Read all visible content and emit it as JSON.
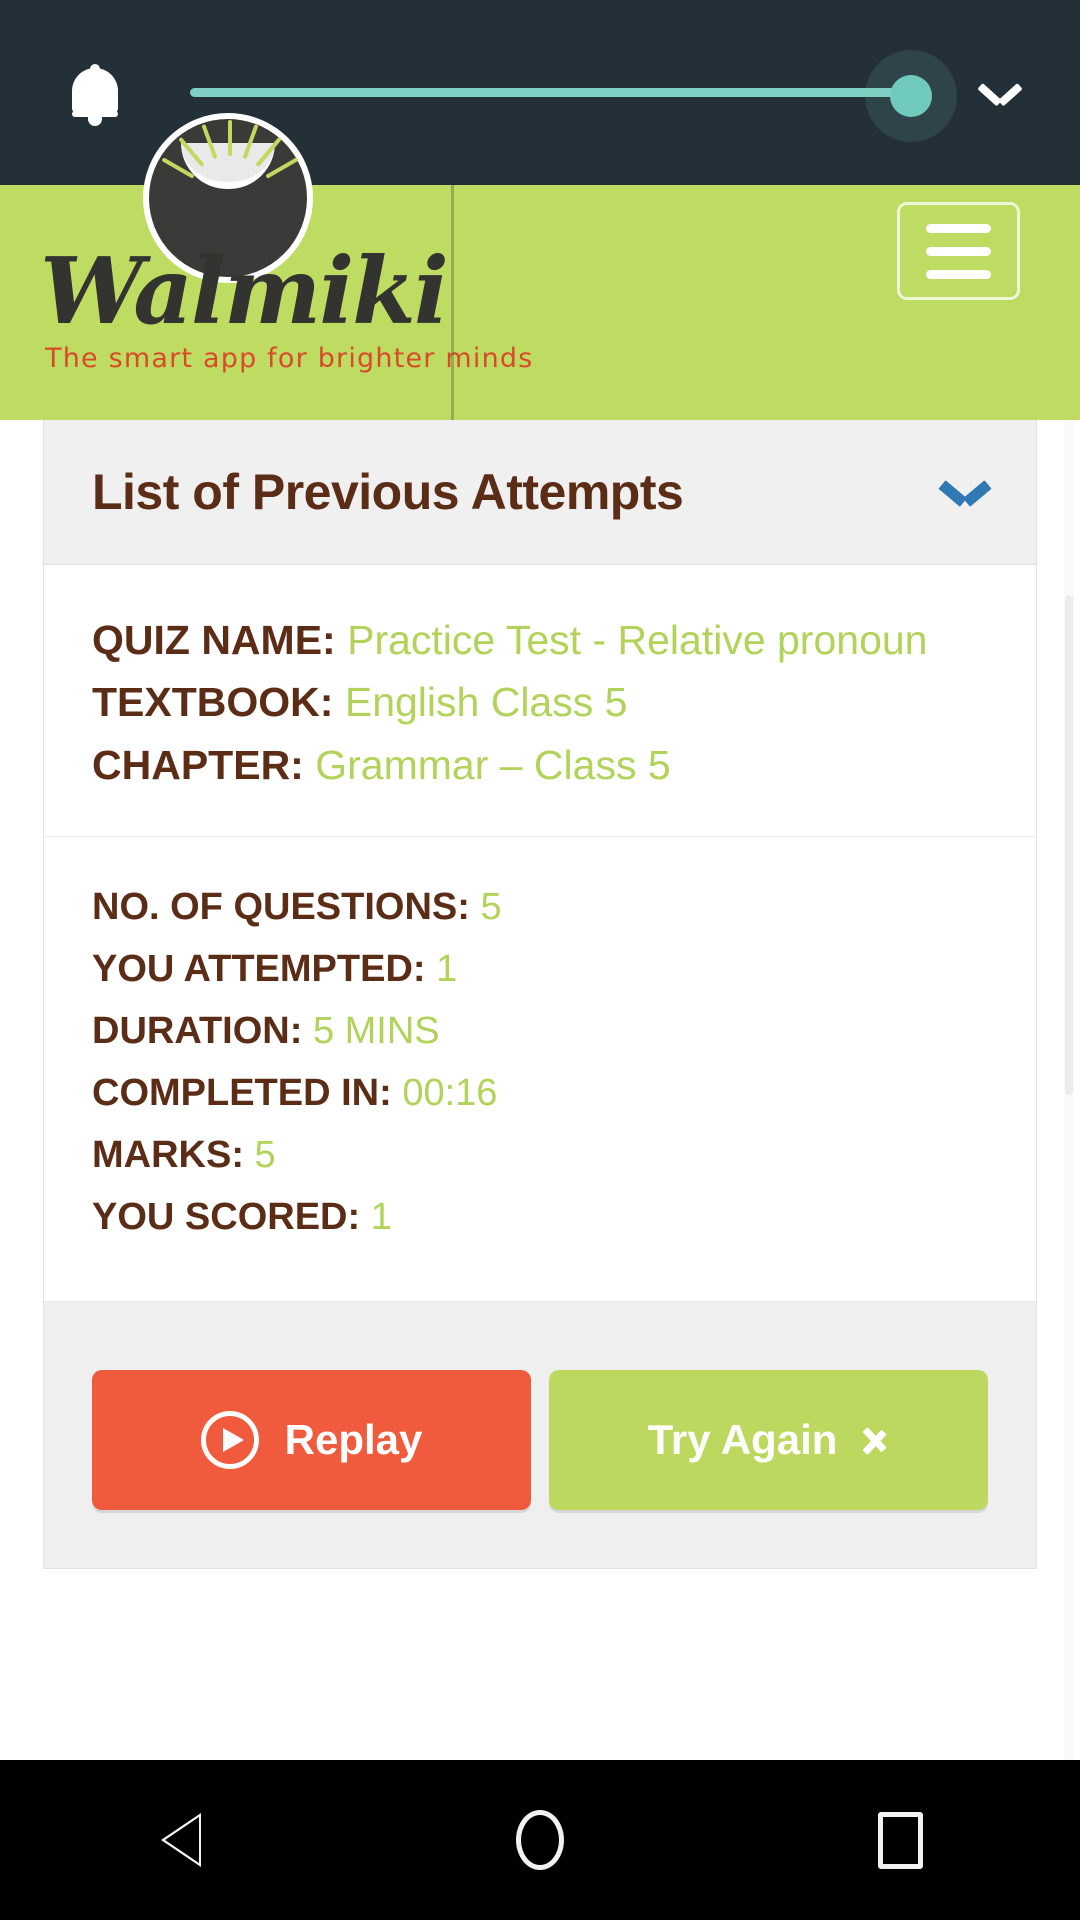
{
  "statusbar": {
    "bell_icon": "notification-bell-icon",
    "volume_slider": {
      "value": 97,
      "min": 0,
      "max": 100,
      "track_color": "#7fd0c4",
      "thumb_color": "#6fc9bc"
    },
    "expand_icon": "chevron-down-icon",
    "background_color": "#233038"
  },
  "brandbar": {
    "logo_name": "Walmiki",
    "tagline": "The smart app for brighter minds",
    "background_color": "#bfdc62",
    "logo_text_color": "#333330",
    "tagline_color": "#d94a2a",
    "menu_icon": "hamburger-menu-icon"
  },
  "card": {
    "header": {
      "title": "List of Previous Attempts",
      "title_color": "#5c2d16",
      "toggle_icon": "chevron-down-icon",
      "toggle_icon_color": "#3079b5"
    },
    "quiz_info": [
      {
        "label": "QUIZ NAME:",
        "value": "Practice Test - Relative pronoun"
      },
      {
        "label": "TEXTBOOK:",
        "value": "English Class 5"
      },
      {
        "label": "CHAPTER:",
        "value": "Grammar – Class 5"
      }
    ],
    "stats": [
      {
        "label": "NO. OF QUESTIONS:",
        "value": "5"
      },
      {
        "label": "YOU ATTEMPTED:",
        "value": "1"
      },
      {
        "label": "DURATION:",
        "value": "5 MINS"
      },
      {
        "label": "COMPLETED IN:",
        "value": "00:16"
      },
      {
        "label": "MARKS:",
        "value": "5"
      },
      {
        "label": "YOU SCORED:",
        "value": "1"
      }
    ],
    "label_color": "#5c2d16",
    "value_color": "#b2d35a",
    "footer": {
      "replay_label": "Replay",
      "replay_icon": "play-circle-icon",
      "replay_color": "#ef5b3c",
      "try_again_label": "Try Again",
      "try_again_icon": "chevron-right-icon",
      "try_again_color": "#bcd85f"
    }
  },
  "navbar": {
    "back_icon": "back-triangle-icon",
    "home_icon": "home-circle-icon",
    "recents_icon": "recents-square-icon",
    "background_color": "#000000"
  }
}
